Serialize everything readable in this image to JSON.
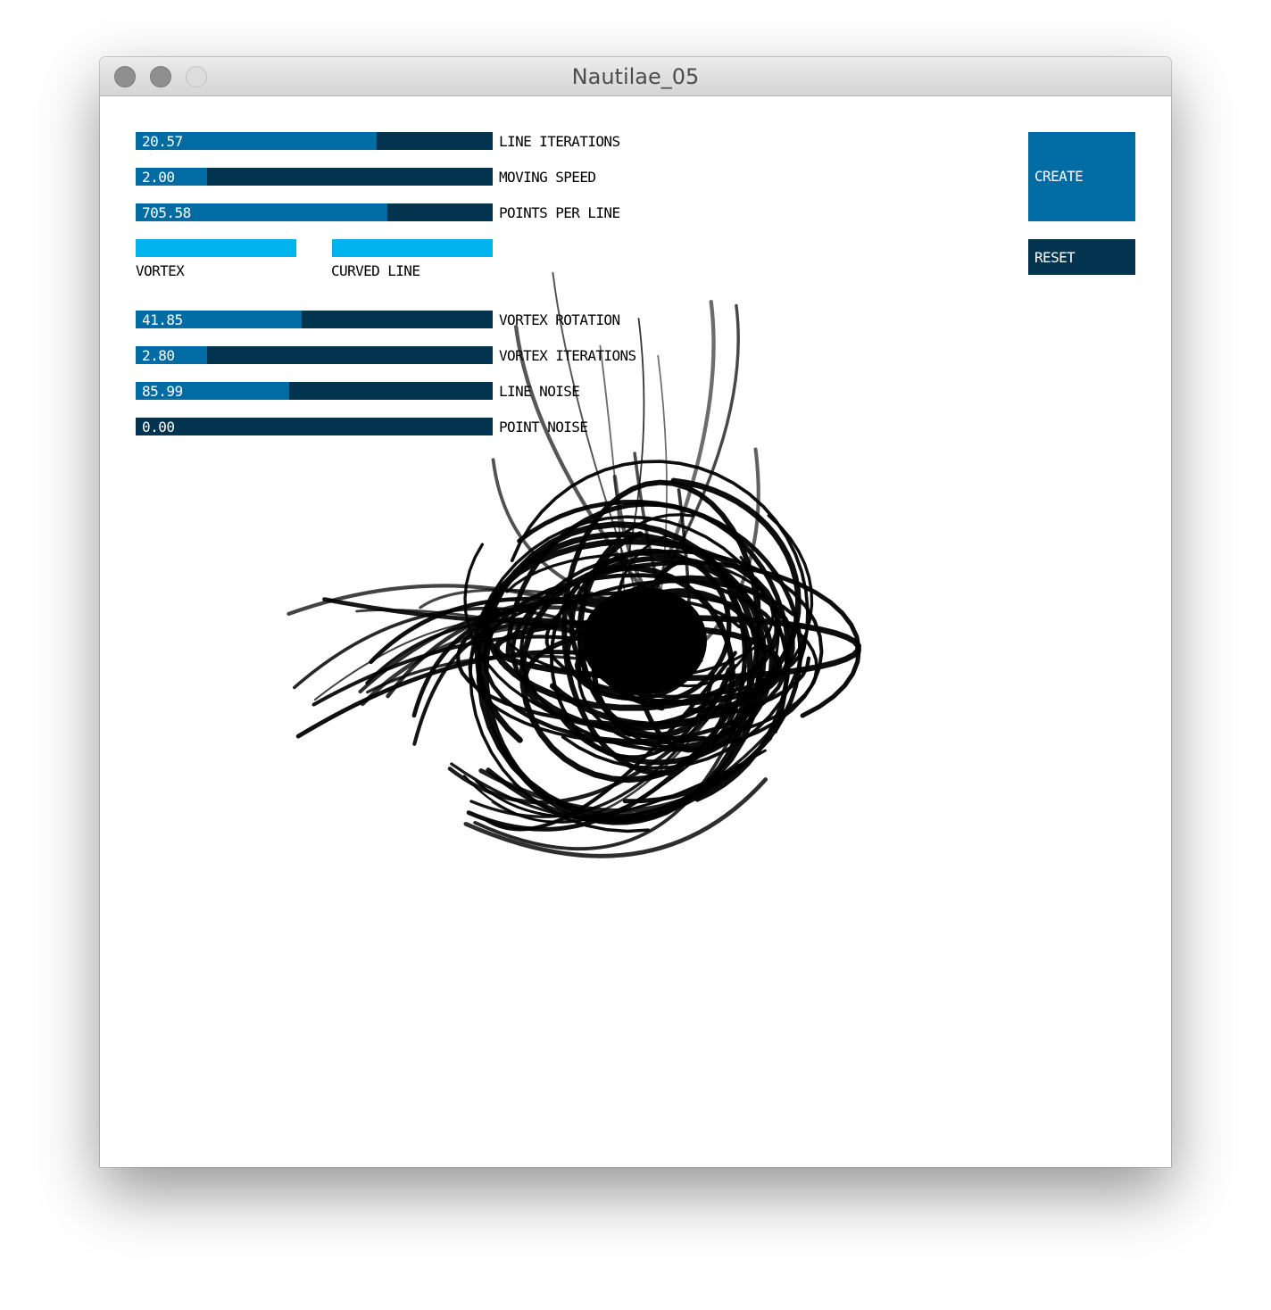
{
  "window": {
    "title": "Nautilae_05"
  },
  "sliders": [
    {
      "id": "line-iterations",
      "value": "20.57",
      "label": "LINE ITERATIONS",
      "fraction": 0.675
    },
    {
      "id": "moving-speed",
      "value": "2.00",
      "label": "MOVING SPEED",
      "fraction": 0.2
    },
    {
      "id": "points-per-line",
      "value": "705.58",
      "label": "POINTS PER LINE",
      "fraction": 0.705
    },
    {
      "id": "vortex-rotation",
      "value": "41.85",
      "label": "VORTEX ROTATION",
      "fraction": 0.465
    },
    {
      "id": "vortex-iterations",
      "value": "2.80",
      "label": "VORTEX ITERATIONS",
      "fraction": 0.2
    },
    {
      "id": "line-noise",
      "value": "85.99",
      "label": "LINE NOISE",
      "fraction": 0.43
    },
    {
      "id": "point-noise",
      "value": "0.00",
      "label": "POINT NOISE",
      "fraction": 0.0
    }
  ],
  "toggles": {
    "vortex": {
      "label": "VORTEX",
      "active": true
    },
    "curved_line": {
      "label": "CURVED LINE",
      "active": true
    }
  },
  "buttons": {
    "create": "CREATE",
    "reset": "RESET"
  },
  "colors": {
    "slider_track": "#02344f",
    "slider_fill": "#016ca4",
    "toggle_active": "#00b4ee",
    "create_button": "#016ca4",
    "reset_button": "#02344f",
    "strokes": "#000000"
  }
}
